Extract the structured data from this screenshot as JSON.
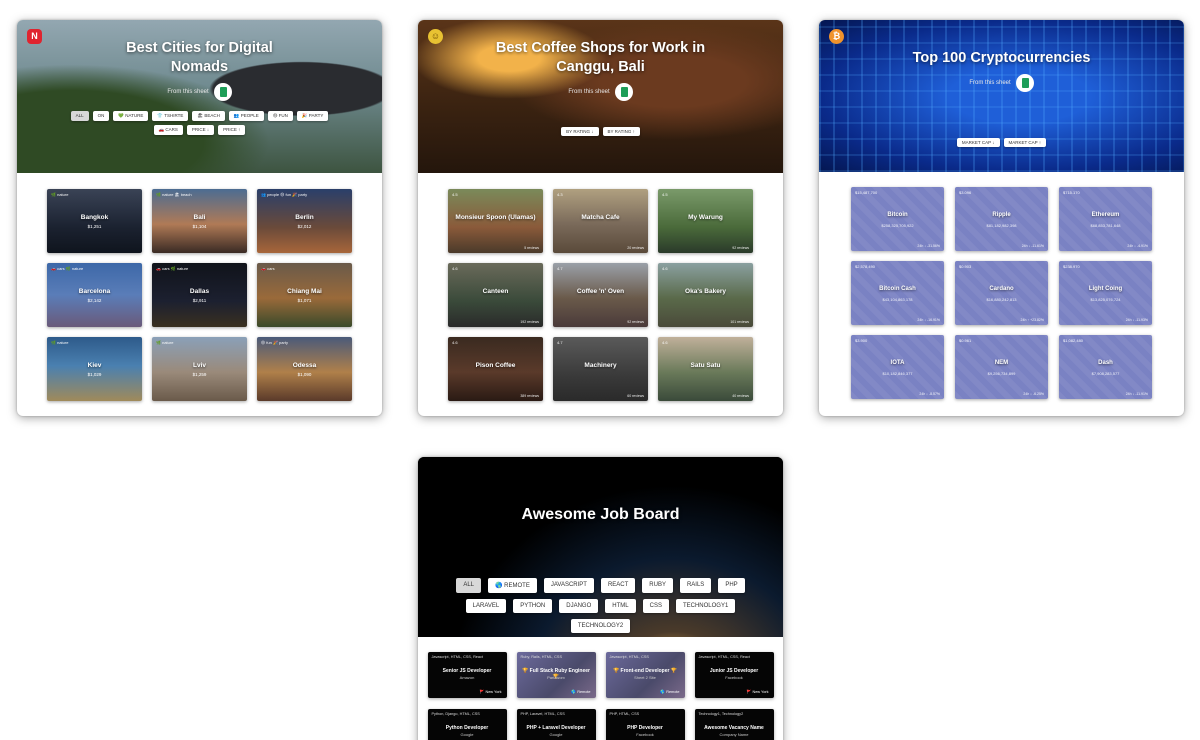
{
  "cities": {
    "title": "Best Cities for Digital Nomads",
    "sheet_label": "From this sheet",
    "chips": [
      "ALL",
      "ON",
      "💚 NATURE",
      "👕 TSHIRTE",
      "🏖 BEACH",
      "👥 PEOPLE",
      "😄 FUN",
      "🎉 PARTY",
      "🚗 CARS",
      "PRICE ↓",
      "PRICE ↑"
    ],
    "cards": [
      {
        "name": "Bangkok",
        "sub": "$1,251",
        "tag": "🌿 nature"
      },
      {
        "name": "Bali",
        "sub": "$1,104",
        "tag": "🌿 nature 🏖 beach"
      },
      {
        "name": "Berlin",
        "sub": "$2,012",
        "tag": "👥 people 😄 fun 🎉 party"
      },
      {
        "name": "Barcelona",
        "sub": "$2,142",
        "tag": "🚗 cars 🌿 nature"
      },
      {
        "name": "Dallas",
        "sub": "$2,911",
        "tag": "🚗 cars 🌿 nature"
      },
      {
        "name": "Chiang Mai",
        "sub": "$1,071",
        "tag": "🚗 cars"
      },
      {
        "name": "Kiev",
        "sub": "$1,029",
        "tag": "🌿 nature"
      },
      {
        "name": "Lviv",
        "sub": "$1,259",
        "tag": "🌿 nature"
      },
      {
        "name": "Odessa",
        "sub": "$1,090",
        "tag": "😄 fun 🎉 party"
      }
    ]
  },
  "coffee": {
    "title": "Best Coffee Shops for Work in Canggu, Bali",
    "sheet_label": "From this sheet",
    "chips": [
      "BY RATING ↓",
      "BY RATING ↑"
    ],
    "cards": [
      {
        "name": "Monsieur Spoon (Ulamas)",
        "rating": "4.5",
        "reviews": "5 reviews"
      },
      {
        "name": "Matcha Cafe",
        "rating": "4.3",
        "reviews": "20 reviews"
      },
      {
        "name": "My Warung",
        "rating": "4.5",
        "reviews": "92 reviews"
      },
      {
        "name": "Canteen",
        "rating": "4.6",
        "reviews": "192 reviews"
      },
      {
        "name": "Coffee 'n' Oven",
        "rating": "4.7",
        "reviews": "92 reviews"
      },
      {
        "name": "Oka's Bakery",
        "rating": "4.6",
        "reviews": "101 reviews"
      },
      {
        "name": "Pison Coffee",
        "rating": "4.6",
        "reviews": "389 reviews"
      },
      {
        "name": "Machinery",
        "rating": "4.7",
        "reviews": "60 reviews"
      },
      {
        "name": "Satu Satu",
        "rating": "4.6",
        "reviews": "40 reviews"
      }
    ]
  },
  "crypto": {
    "title": "Top 100 Cryptocurrencies",
    "sheet_label": "From this sheet",
    "chips": [
      "MARKET CAP ↓",
      "MARKET CAP ↑"
    ],
    "cards": [
      {
        "name": "Bitcoin",
        "price": "$15,487,700",
        "cap": "$258,325,705,922",
        "change": "24h ↓ -31.56%"
      },
      {
        "name": "Ripple",
        "price": "$3.096",
        "cap": "$81,182,982,398",
        "change": "24h ↓ -11.61%"
      },
      {
        "name": "Ethereum",
        "price": "$715.170",
        "cap": "$68,853,781,648",
        "change": "24h ↓ -4.91%"
      },
      {
        "name": "Bitcoin Cash",
        "price": "$2,578,490",
        "cap": "$43,104,863,178",
        "change": "24h ↓ -16.91%"
      },
      {
        "name": "Cardano",
        "price": "$0.903",
        "cap": "$16,880,242,813",
        "change": "24h ↑ +23.82%"
      },
      {
        "name": "Light Coing",
        "price": "$238.970",
        "cap": "$13,825,076,724",
        "change": "24h ↓ -11.93%"
      },
      {
        "name": "IOTA",
        "price": "$3.900",
        "cap": "$10,182,846,377",
        "change": "24h ↓ -8.57%"
      },
      {
        "name": "NEM",
        "price": "$0.961",
        "cap": "$9,256,734,899",
        "change": "24h ↓ -6.25%"
      },
      {
        "name": "Dash",
        "price": "$1,082,480",
        "cap": "$7,908,283,577",
        "change": "24h ↓ -11.91%"
      }
    ]
  },
  "jobs": {
    "title": "Awesome Job Board",
    "chips": [
      "ALL",
      "🌎 REMOTE",
      "JAVASCRIPT",
      "REACT",
      "RUBY",
      "RAILS",
      "PHP",
      "LARAVEL",
      "PYTHON",
      "DJANGO",
      "HTML",
      "CSS",
      "TECHNOLOGY1",
      "TECHNOLOGY2"
    ],
    "cards": [
      {
        "tags": "Javascript, HTML, CSS, React",
        "title": "Senior JS Developer",
        "company": "Amazon",
        "location": "🚩 New York"
      },
      {
        "tags": "Ruby, Rails, HTML, CSS",
        "title": "🏆 Full Stack Ruby Engineer 🏆",
        "company": "Parlaworx",
        "location": "🌎 Remote"
      },
      {
        "tags": "Javascript, HTML, CSS",
        "title": "🏆 Front-end Developer 🏆",
        "company": "Sheet 2 Site",
        "location": "🌎 Remote"
      },
      {
        "tags": "Javascript, HTML, CSS, React",
        "title": "Junior JS Developer",
        "company": "Facebook",
        "location": "🚩 New York"
      },
      {
        "tags": "Python, Django, HTML, CSS",
        "title": "Python Developer",
        "company": "Google",
        "location": ""
      },
      {
        "tags": "PHP, Laravel, HTML, CSS",
        "title": "PHP + Laravel Developer",
        "company": "Google",
        "location": ""
      },
      {
        "tags": "PHP, HTML, CSS",
        "title": "PHP Developer",
        "company": "Facebook",
        "location": ""
      },
      {
        "tags": "Technology1, Technology2",
        "title": "Awesome Vacancy Name",
        "company": "Company Name",
        "location": ""
      }
    ]
  },
  "colors": {
    "crypto_card": "#7a82c3",
    "sheets_green": "#1e9e58",
    "brand_red": "#e0242f"
  }
}
